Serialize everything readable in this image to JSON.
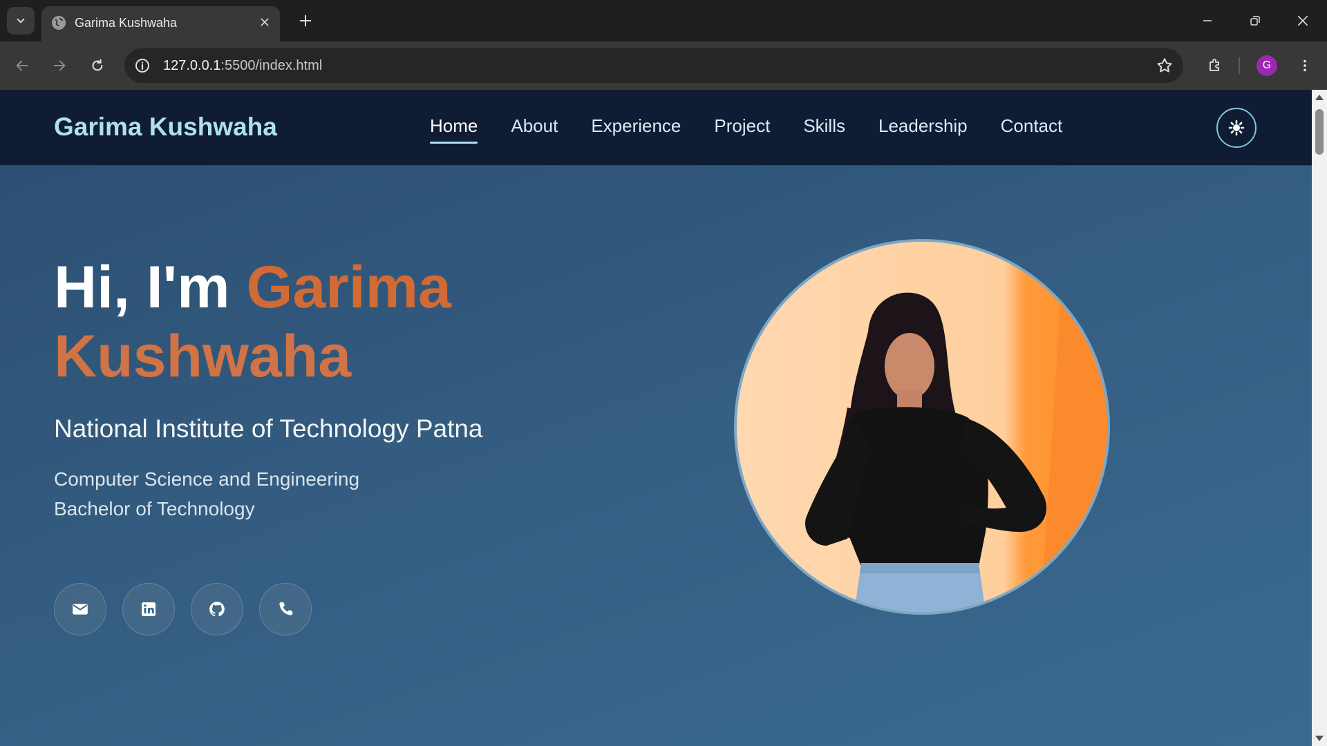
{
  "browser": {
    "tab_title": "Garima Kushwaha",
    "url_host": "127.0.0.1",
    "url_path": ":5500/index.html",
    "profile_initial": "G"
  },
  "site": {
    "brand": "Garima Kushwaha",
    "nav": [
      {
        "label": "Home",
        "active": true
      },
      {
        "label": "About"
      },
      {
        "label": "Experience"
      },
      {
        "label": "Project"
      },
      {
        "label": "Skills"
      },
      {
        "label": "Leadership"
      },
      {
        "label": "Contact"
      }
    ]
  },
  "hero": {
    "greeting": "Hi, I'm ",
    "first_name": "Garima",
    "last_name": "Kushwaha",
    "institute": "National Institute of Technology Patna",
    "branch": "Computer Science and Engineering",
    "degree": "Bachelor of Technology",
    "socials": [
      "envelope-icon",
      "linkedin-icon",
      "github-icon",
      "phone-icon"
    ]
  },
  "colors": {
    "accent_orange": "#d26a36",
    "brand_cyan": "#aee0ee",
    "header_bg": "#0f1c33"
  }
}
